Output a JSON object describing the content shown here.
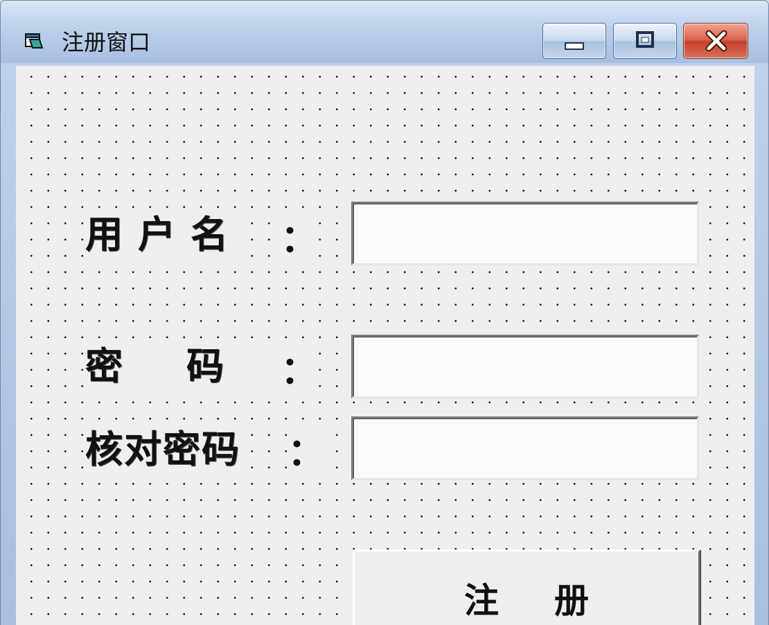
{
  "window": {
    "title": "注册窗口",
    "icon": "form-icon",
    "caption_icons": {
      "minimize": "minimize-icon",
      "maximize": "maximize-icon",
      "close": "close-icon"
    }
  },
  "form": {
    "username_label": "用户名",
    "password_label": "密码",
    "confirm_label": "核对密码",
    "colon": "：",
    "username_value": "",
    "password_value": "",
    "confirm_value": "",
    "register_label": "注册"
  },
  "colors": {
    "client_bg": "#efeff2",
    "close_button": "#d9614a"
  }
}
